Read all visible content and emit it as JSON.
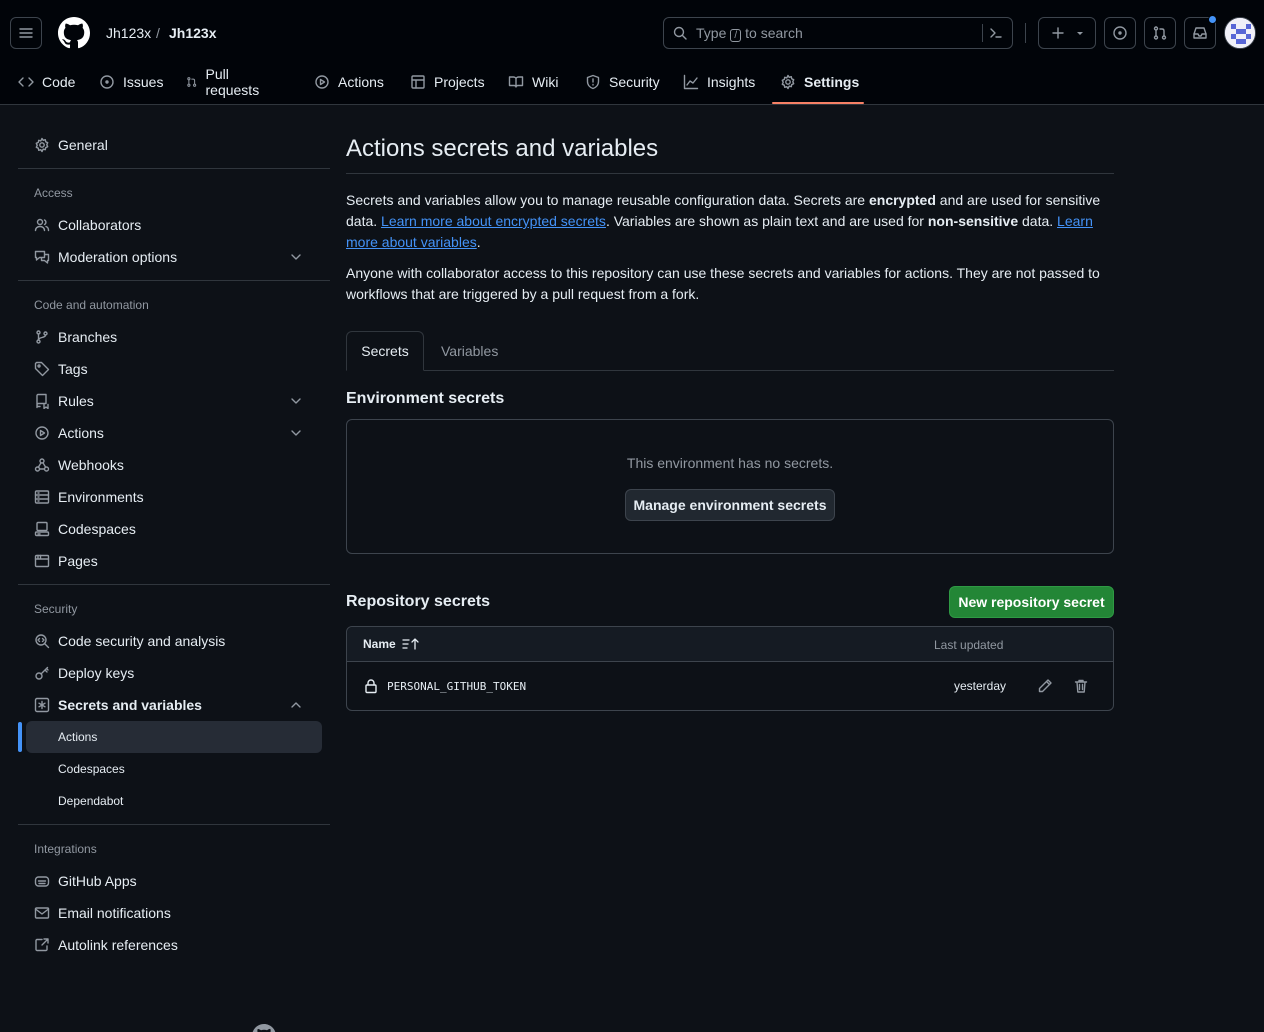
{
  "header": {
    "owner": "Jh123x",
    "separator": "/",
    "repo": "Jh123x",
    "search": {
      "prefix": "Type",
      "key": "/",
      "suffix": "to search"
    }
  },
  "repo_tabs": [
    {
      "label": "Code",
      "icon": "code-icon"
    },
    {
      "label": "Issues",
      "icon": "issue-icon"
    },
    {
      "label": "Pull requests",
      "icon": "pull-request-icon"
    },
    {
      "label": "Actions",
      "icon": "play-icon"
    },
    {
      "label": "Projects",
      "icon": "table-icon"
    },
    {
      "label": "Wiki",
      "icon": "book-icon"
    },
    {
      "label": "Security",
      "icon": "shield-icon"
    },
    {
      "label": "Insights",
      "icon": "graph-icon"
    },
    {
      "label": "Settings",
      "icon": "gear-icon",
      "active": true
    }
  ],
  "sidebar": {
    "general": "General",
    "access_heading": "Access",
    "collaborators": "Collaborators",
    "moderation": "Moderation options",
    "code_heading": "Code and automation",
    "branches": "Branches",
    "tags": "Tags",
    "rules": "Rules",
    "actions": "Actions",
    "webhooks": "Webhooks",
    "environments": "Environments",
    "codespaces": "Codespaces",
    "pages": "Pages",
    "security_heading": "Security",
    "code_security": "Code security and analysis",
    "deploy_keys": "Deploy keys",
    "secrets": "Secrets and variables",
    "secrets_sub": [
      "Actions",
      "Codespaces",
      "Dependabot"
    ],
    "integrations_heading": "Integrations",
    "github_apps": "GitHub Apps",
    "email": "Email notifications",
    "autolink": "Autolink references"
  },
  "main": {
    "title": "Actions secrets and variables",
    "intro": {
      "t1": "Secrets and variables allow you to manage reusable configuration data. Secrets are ",
      "b1": "encrypted",
      "t2": " and are used for sensitive data. ",
      "link1": "Learn more about encrypted secrets",
      "t3": ". Variables are shown as plain text and are used for ",
      "b2": "non-sensitive",
      "t4": " data. ",
      "link2": "Learn more about variables",
      "t5": "."
    },
    "note": "Anyone with collaborator access to this repository can use these secrets and variables for actions. They are not passed to workflows that are triggered by a pull request from a fork.",
    "tabs": {
      "secrets": "Secrets",
      "variables": "Variables"
    },
    "env": {
      "heading": "Environment secrets",
      "empty": "This environment has no secrets.",
      "button": "Manage environment secrets"
    },
    "repo": {
      "heading": "Repository secrets",
      "new_button": "New repository secret",
      "col_name": "Name",
      "col_updated": "Last updated",
      "rows": [
        {
          "name": "PERSONAL_GITHUB_TOKEN",
          "updated": "yesterday"
        }
      ]
    }
  }
}
